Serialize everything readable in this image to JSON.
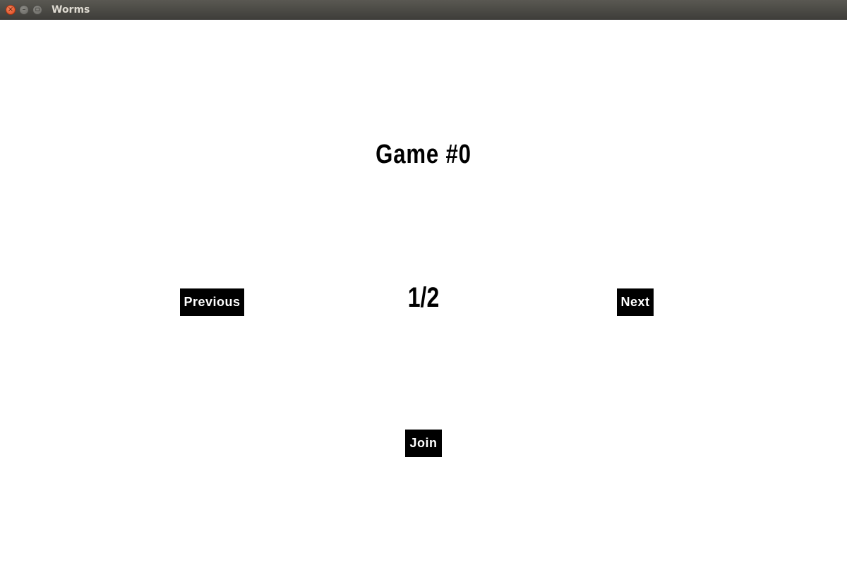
{
  "window": {
    "title": "Worms",
    "controls": {
      "close_icon": "close-icon",
      "minimize_icon": "minimize-icon",
      "maximize_icon": "maximize-icon"
    }
  },
  "lobby": {
    "game_title": "Game #0",
    "page_indicator": "1/2",
    "previous_label": "Previous",
    "next_label": "Next",
    "join_label": "Join"
  },
  "colors": {
    "background": "#ffffff",
    "button_bg": "#000000",
    "button_text": "#ffffff",
    "titlebar": "#3f3e3a",
    "close_button": "#e0461c"
  }
}
